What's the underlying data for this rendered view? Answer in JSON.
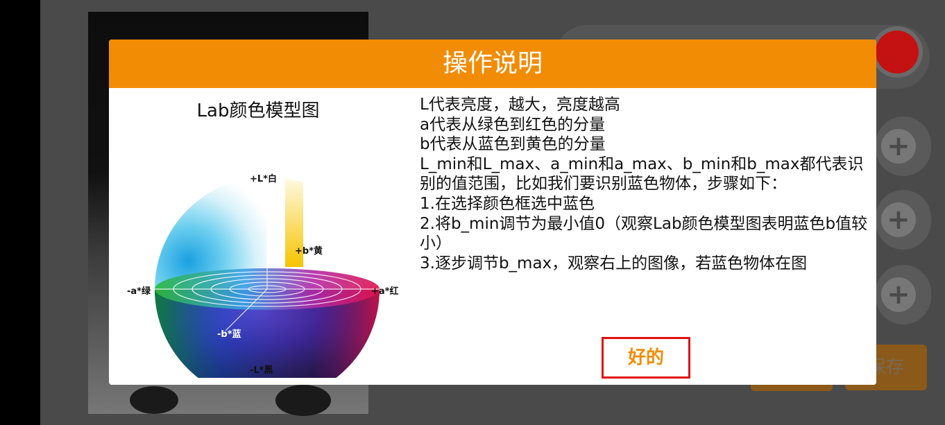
{
  "dialog": {
    "title": "操作说明",
    "diagram_title": "Lab颜色模型图",
    "axis_labels": {
      "top": "+L*白",
      "right_upper": "+b*黄",
      "left": "-a*绿",
      "right": "+a*红",
      "front": "-b*蓝",
      "bottom": "-L*黑"
    },
    "lines": [
      "L代表亮度，越大，亮度越高",
      "a代表从绿色到红色的分量",
      "b代表从蓝色到黄色的分量",
      "L_min和L_max、a_min和a_max、b_min和b_max都代表识别的值范围，比如我们要识别蓝色物体，步骤如下：",
      "1.在选择颜色框选中蓝色",
      "2.将b_min调节为最小值0（观察Lab颜色模型图表明蓝色b值较小）",
      "3.逐步调节b_max，观察右上的图像，若蓝色物体在图"
    ],
    "ok_label": "好的"
  },
  "background": {
    "save_label": "保存",
    "plus_glyph": "+",
    "colors": {
      "accent": "#f28c05",
      "red_indicator": "#c41212"
    }
  }
}
